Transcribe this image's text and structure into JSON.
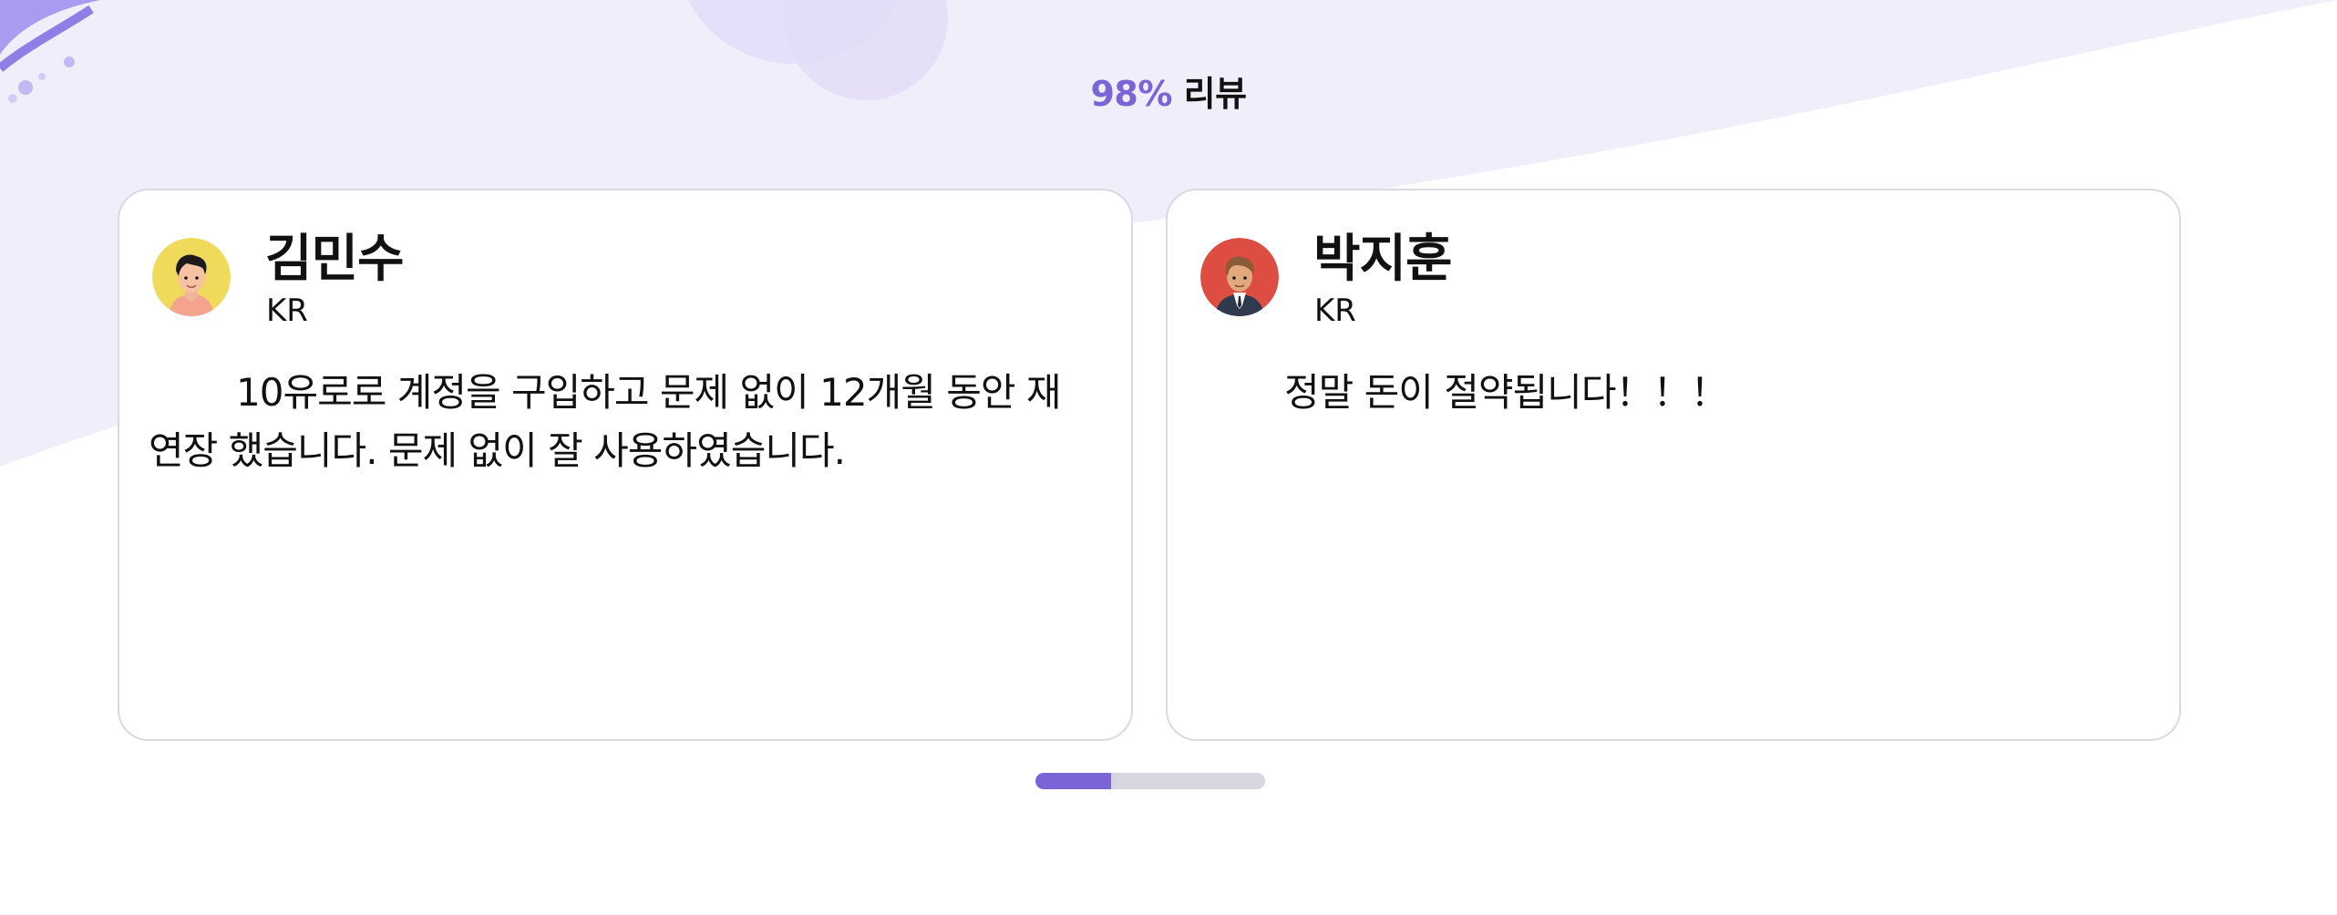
{
  "header": {
    "percent": "98%",
    "label": " 리뷰"
  },
  "reviews": [
    {
      "name": "김민수",
      "country": "KR",
      "text": "10유로로 계정을 구입하고 문제 없이 12개월 동안 재 연장 했습니다. 문제 없이 잘 사용하였습니다.",
      "avatar_icon": "avatar-man-yellow-icon"
    },
    {
      "name": "박지훈",
      "country": "KR",
      "text": "정말 돈이 절약됩니다！！！",
      "avatar_icon": "avatar-man-red-icon"
    }
  ],
  "pager": {
    "progress": 0.33
  },
  "colors": {
    "accent": "#7a64d6",
    "background_tint": "#f0eefb",
    "card_border": "#d9d9e0",
    "pager_track": "#d6d7de"
  }
}
